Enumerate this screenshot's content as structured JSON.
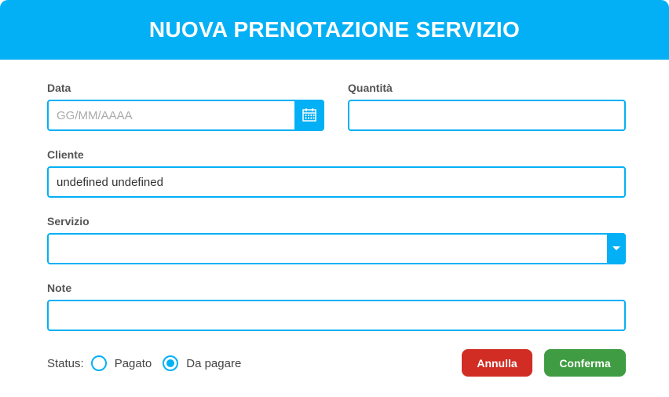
{
  "header": {
    "title": "NUOVA PRENOTAZIONE SERVIZIO"
  },
  "form": {
    "data": {
      "label": "Data",
      "placeholder": "GG/MM/AAAA",
      "value": "",
      "icon": "calendar-icon"
    },
    "quantita": {
      "label": "Quantità",
      "value": ""
    },
    "cliente": {
      "label": "Cliente",
      "value": "undefined undefined"
    },
    "servizio": {
      "label": "Servizio",
      "value": "",
      "icon": "chevron-down-icon"
    },
    "note": {
      "label": "Note",
      "value": ""
    }
  },
  "status": {
    "label": "Status:",
    "options": [
      {
        "label": "Pagato",
        "checked": false
      },
      {
        "label": "Da pagare",
        "checked": true
      }
    ]
  },
  "actions": {
    "cancel_label": "Annulla",
    "confirm_label": "Conferma"
  },
  "colors": {
    "accent": "#03b0f5",
    "cancel": "#d12d25",
    "confirm": "#3f9c42"
  }
}
